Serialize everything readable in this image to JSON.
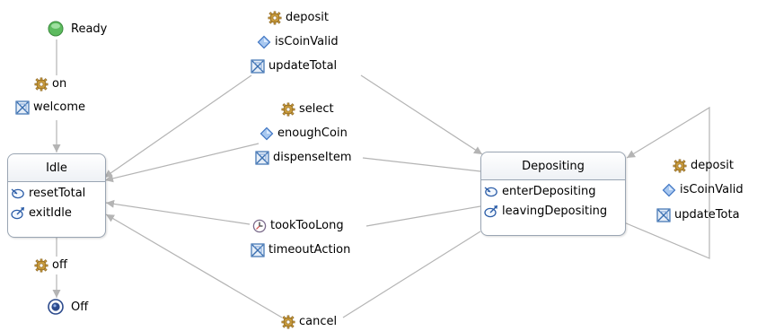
{
  "diagram": {
    "pseudostates": {
      "initial": {
        "label": "Ready"
      },
      "final": {
        "label": "Off"
      }
    },
    "states": {
      "idle": {
        "name": "Idle",
        "entry": "resetTotal",
        "exit": "exitIdle"
      },
      "depositing": {
        "name": "Depositing",
        "entry": "enterDepositing",
        "exit": "leavingDepositing"
      }
    },
    "transitions": {
      "on": {
        "trigger": "on",
        "effect": "welcome"
      },
      "off": {
        "trigger": "off"
      },
      "deposit_top": {
        "trigger": "deposit",
        "guard": "isCoinValid",
        "effect": "updateTotal"
      },
      "select": {
        "trigger": "select",
        "guard": "enoughCoin",
        "effect": "dispenseItem"
      },
      "timeout": {
        "trigger": "tookTooLong",
        "effect": "timeoutAction"
      },
      "cancel": {
        "trigger": "cancel"
      },
      "deposit_self": {
        "trigger": "deposit",
        "guard": "isCoinValid",
        "effect": "updateTota"
      }
    },
    "icons": {
      "trigger": "gear-icon",
      "time_trigger": "clock-icon",
      "guard": "diamond-icon",
      "effect": "action-icon",
      "entry": "entry-icon",
      "exit": "exit-icon",
      "initial": "initial-state-icon",
      "final": "final-state-icon"
    },
    "colors": {
      "edge": "#b4b4b4",
      "state_border": "#9aa5b3",
      "guard": "#5b8ed6",
      "effect": "#3a6fb0",
      "trigger": "#c89b3c",
      "initial": "#4caf50",
      "final": "#2c4a8c"
    }
  }
}
